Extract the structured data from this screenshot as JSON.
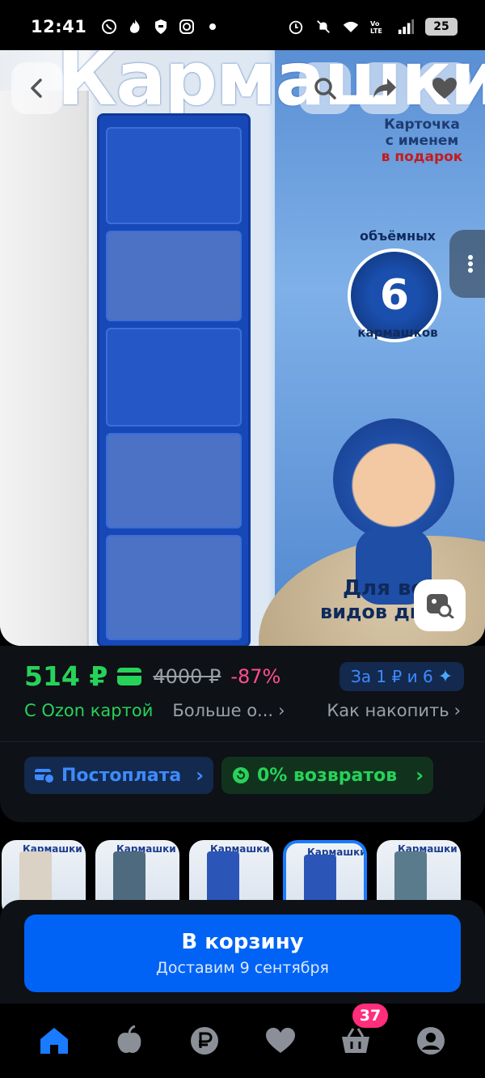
{
  "status_bar": {
    "time": "12:41",
    "battery": "25",
    "left_icons": [
      "whatsapp-icon",
      "fire-icon",
      "shield-icon",
      "instagram-icon",
      "dot-icon"
    ],
    "right_icons": [
      "alarm-icon",
      "mute-icon",
      "wifi-icon",
      "volte-icon",
      "signal-icon"
    ]
  },
  "hero": {
    "title": "Кармашки",
    "card_caption_line1": "Карточка",
    "card_caption_line2": "с именем",
    "card_caption_line3": "в подарок",
    "badge_top": "объёмных",
    "badge_number": "6",
    "badge_bottom": "кармашков",
    "bottom_text_1": "Для вс",
    "bottom_text_2": "видов дв",
    "colors": {
      "organizer": "#1848b8",
      "wall": "#5a8fd4"
    }
  },
  "price": {
    "current": "514 ₽",
    "old": "4000 ₽",
    "discount": "-87%",
    "bonus": "За 1 ₽ и 6",
    "ozon_card_label": "С Ozon картой",
    "more_label": "Больше о...",
    "how_label": "Как накопить"
  },
  "chips": {
    "postpay": "Постоплата",
    "returns": "0% возвратов"
  },
  "thumbnails": [
    {
      "label": "Кармашки"
    },
    {
      "label": "Кармашки"
    },
    {
      "label": "Кармашки"
    },
    {
      "label": "Кармашки",
      "selected": true
    },
    {
      "label": "Кармашки"
    }
  ],
  "cart": {
    "title": "В корзину",
    "subtitle": "Доставим 9 сентября"
  },
  "nav": {
    "cart_count": "37",
    "items": [
      "home-icon",
      "fresh-icon",
      "ruble-icon",
      "heart-icon",
      "basket-icon",
      "profile-icon"
    ]
  },
  "colors": {
    "accent_green": "#27d25a",
    "accent_blue": "#0063f5",
    "discount_pink": "#ff4f8b",
    "badge_pink": "#ff2d7a"
  }
}
